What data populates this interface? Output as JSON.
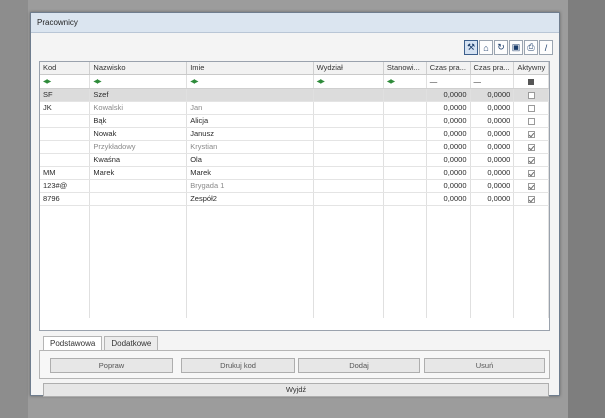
{
  "window": {
    "title": "Pracownicy"
  },
  "toolbar": {
    "buttons": [
      {
        "name": "tools-icon",
        "glyph": "⚒"
      },
      {
        "name": "home-icon",
        "glyph": "⌂"
      },
      {
        "name": "refresh-icon",
        "glyph": "↻"
      },
      {
        "name": "save-icon",
        "glyph": "▣"
      },
      {
        "name": "print-icon",
        "glyph": "⎙"
      },
      {
        "name": "edit-icon",
        "glyph": "/"
      }
    ]
  },
  "grid": {
    "columns": [
      "Kod",
      "Nazwisko",
      "Imie",
      "Wydział",
      "Stanowi...",
      "Czas pra...",
      "Czas pra...",
      "Aktywny"
    ],
    "filter_dash": "—",
    "rows": [
      {
        "kod": "SF",
        "nazwisko": "Szef",
        "imie": "",
        "wydzial": "",
        "stanowisko": "",
        "czas1": "0,0000",
        "czas2": "0,0000",
        "aktywny": false,
        "selected": true,
        "dim": false
      },
      {
        "kod": "JK",
        "nazwisko": "Kowalski",
        "imie": "Jan",
        "wydzial": "",
        "stanowisko": "",
        "czas1": "0,0000",
        "czas2": "0,0000",
        "aktywny": false,
        "selected": false,
        "dim": true
      },
      {
        "kod": "",
        "nazwisko": "Bąk",
        "imie": "Alicja",
        "wydzial": "",
        "stanowisko": "",
        "czas1": "0,0000",
        "czas2": "0,0000",
        "aktywny": false,
        "selected": false,
        "dim": false
      },
      {
        "kod": "",
        "nazwisko": "Nowak",
        "imie": "Janusz",
        "wydzial": "",
        "stanowisko": "",
        "czas1": "0,0000",
        "czas2": "0,0000",
        "aktywny": true,
        "selected": false,
        "dim": false
      },
      {
        "kod": "",
        "nazwisko": "Przykładowy",
        "imie": "Krystian",
        "wydzial": "",
        "stanowisko": "",
        "czas1": "0,0000",
        "czas2": "0,0000",
        "aktywny": true,
        "selected": false,
        "dim": true
      },
      {
        "kod": "",
        "nazwisko": "Kwaśna",
        "imie": "Ola",
        "wydzial": "",
        "stanowisko": "",
        "czas1": "0,0000",
        "czas2": "0,0000",
        "aktywny": true,
        "selected": false,
        "dim": false
      },
      {
        "kod": "MM",
        "nazwisko": "Marek",
        "imie": "Marek",
        "wydzial": "",
        "stanowisko": "",
        "czas1": "0,0000",
        "czas2": "0,0000",
        "aktywny": true,
        "selected": false,
        "dim": false
      },
      {
        "kod": "123#@",
        "nazwisko": "",
        "imie": "Brygada 1",
        "wydzial": "",
        "stanowisko": "",
        "czas1": "0,0000",
        "czas2": "0,0000",
        "aktywny": true,
        "selected": false,
        "dim": true
      },
      {
        "kod": "8796",
        "nazwisko": "",
        "imie": "Zespół2",
        "wydzial": "",
        "stanowisko": "",
        "czas1": "0,0000",
        "czas2": "0,0000",
        "aktywny": true,
        "selected": false,
        "dim": false
      }
    ]
  },
  "tabs": {
    "items": [
      "Podstawowa",
      "Dodatkowe"
    ],
    "active": 0
  },
  "actions": {
    "popraw": "Popraw",
    "drukuj": "Drukuj kod",
    "dodaj": "Dodaj",
    "usun": "Usuń"
  },
  "exit_label": "Wyjdź"
}
